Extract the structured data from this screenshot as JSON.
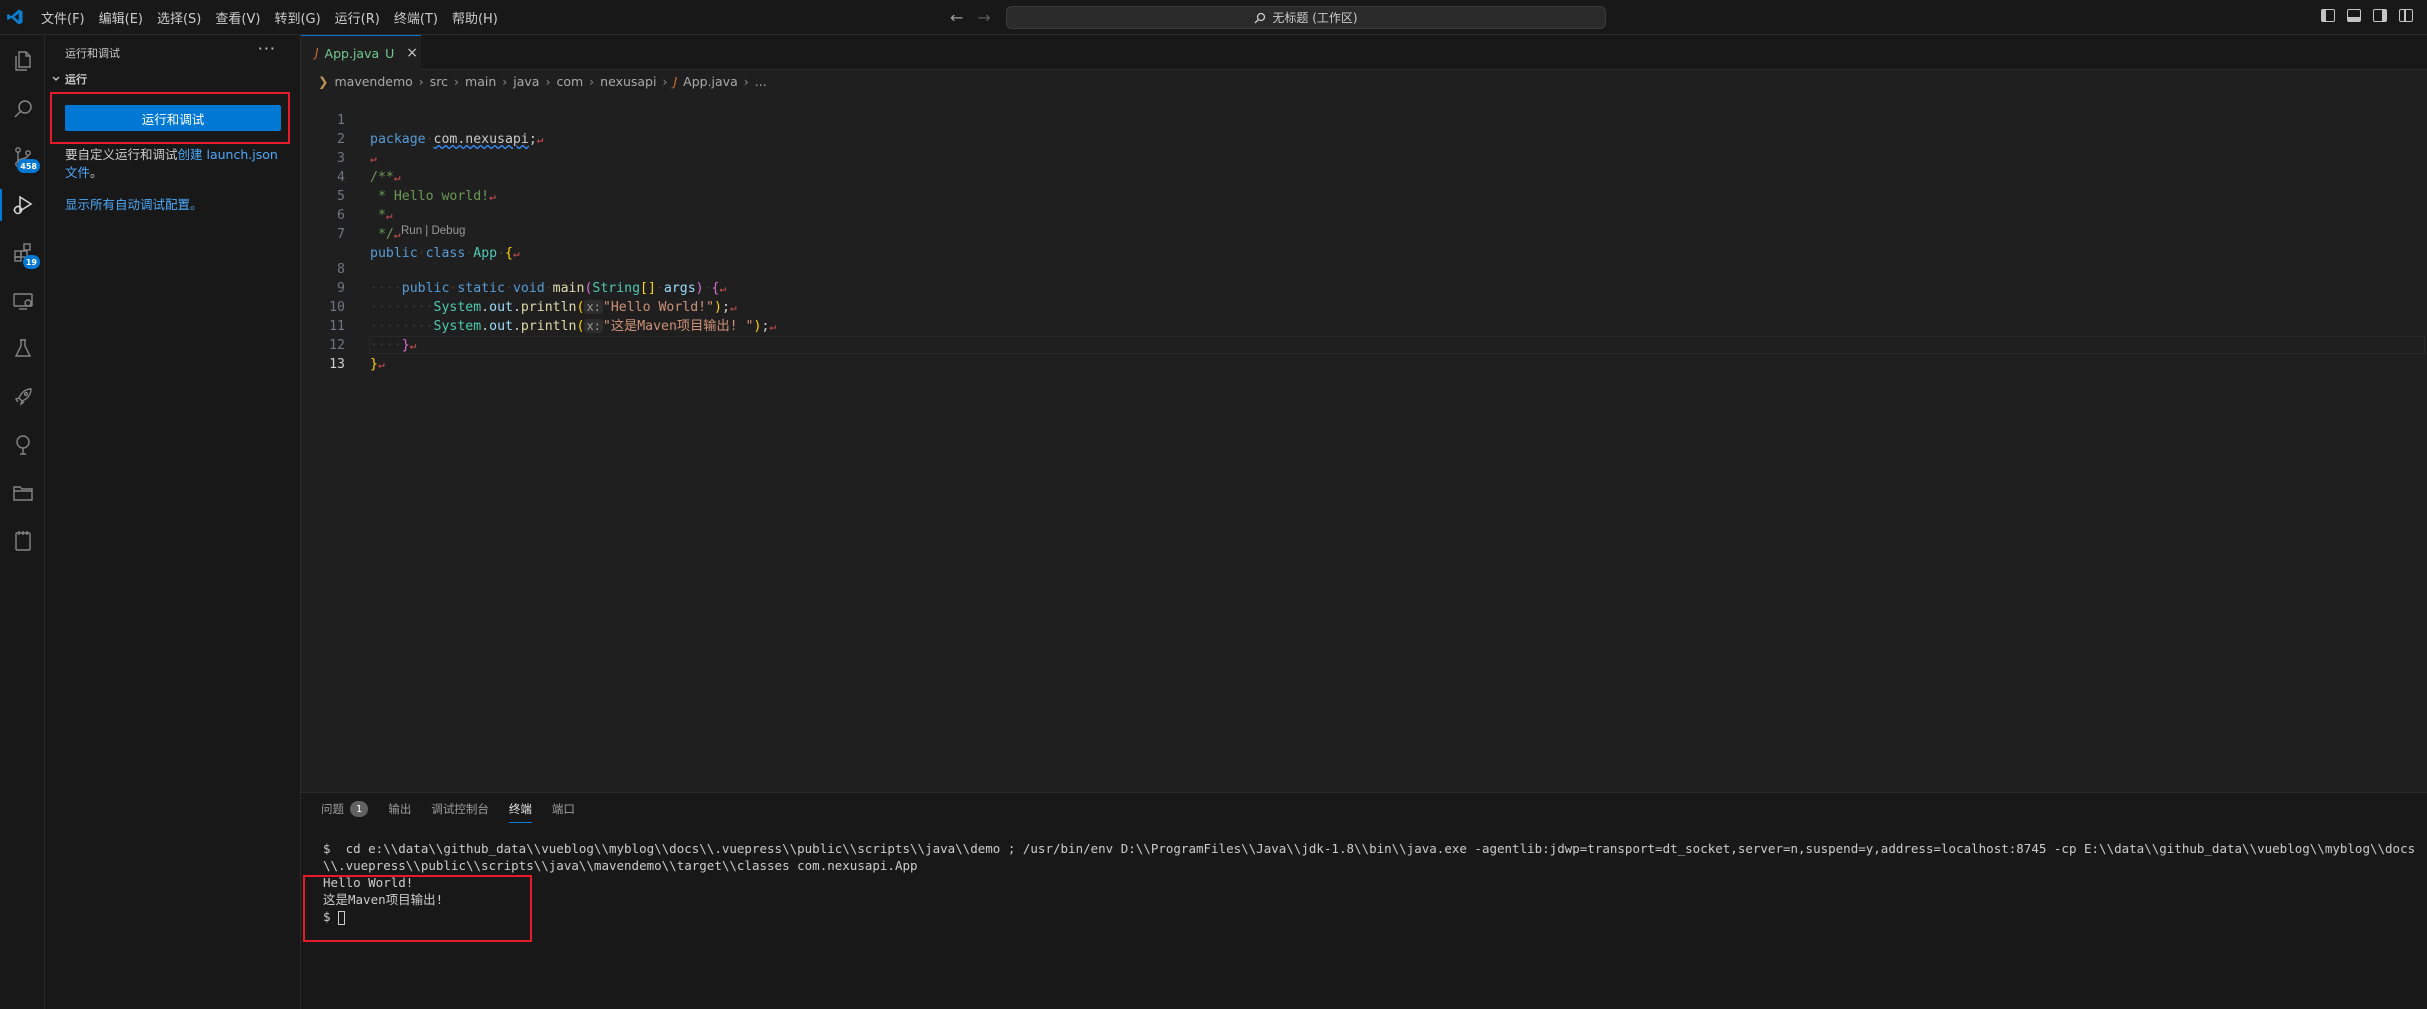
{
  "menu": {
    "items": [
      "文件(F)",
      "编辑(E)",
      "选择(S)",
      "查看(V)",
      "转到(G)",
      "运行(R)",
      "终端(T)",
      "帮助(H)"
    ]
  },
  "command_center": {
    "label": "无标题 (工作区)"
  },
  "activity": {
    "source_control_badge": "458",
    "extensions_badge": "19"
  },
  "sidebar": {
    "title": "运行和调试",
    "section": "运行",
    "run_button": "运行和调试",
    "customize_text": "要自定义运行和调试",
    "create_link": "创建 launch.json",
    "create_link2": "文件",
    "period": "。",
    "show_all": "显示所有自动调试配置。"
  },
  "tab": {
    "filename": "App.java",
    "status": "U"
  },
  "breadcrumb": [
    "mavendemo",
    "src",
    "main",
    "java",
    "com",
    "nexusapi",
    "App.java",
    "..."
  ],
  "code": {
    "line_numbers": [
      "1",
      "2",
      "3",
      "4",
      "5",
      "6",
      "7",
      "8",
      "9",
      "10",
      "11",
      "12",
      "13"
    ],
    "codelens": "Run | Debug",
    "package_kw": "package",
    "package_name": "com.nexusapi",
    "comment_open": "/**",
    "comment_hello": " * Hello world!",
    "comment_star": " *",
    "comment_close": " */",
    "public_kw": "public",
    "class_kw": "class",
    "class_name": "App",
    "static_kw": "static",
    "void_kw": "void",
    "main_fn": "main",
    "string_type": "String",
    "args": "args",
    "system": "System",
    "out": "out",
    "println": "println",
    "hint": "x:",
    "str1": "\"Hello World!\"",
    "str2": "\"这是Maven项目输出! \""
  },
  "panel": {
    "tabs": [
      "问题",
      "输出",
      "调试控制台",
      "终端",
      "端口"
    ],
    "problems_count": "1",
    "terminal_command": "$  cd e:\\\\data\\\\github_data\\\\vueblog\\\\myblog\\\\docs\\\\.vuepress\\\\public\\\\scripts\\\\java\\\\demo ; /usr/bin/env D:\\\\ProgramFiles\\\\Java\\\\jdk-1.8\\\\bin\\\\java.exe -agentlib:jdwp=transport=dt_socket,server=n,suspend=y,address=localhost:8745 -cp E:\\\\data\\\\github_data\\\\vueblog\\\\myblog\\\\docs\\\\.vuepress\\\\public\\\\scripts\\\\java\\\\mavendemo\\\\target\\\\classes com.nexusapi.App",
    "output_line1": "Hello World!",
    "output_line2": "这是Maven项目输出!",
    "prompt": "$"
  },
  "colors": {
    "accent": "#0078d4",
    "highlight_box": "#e51a2a"
  }
}
